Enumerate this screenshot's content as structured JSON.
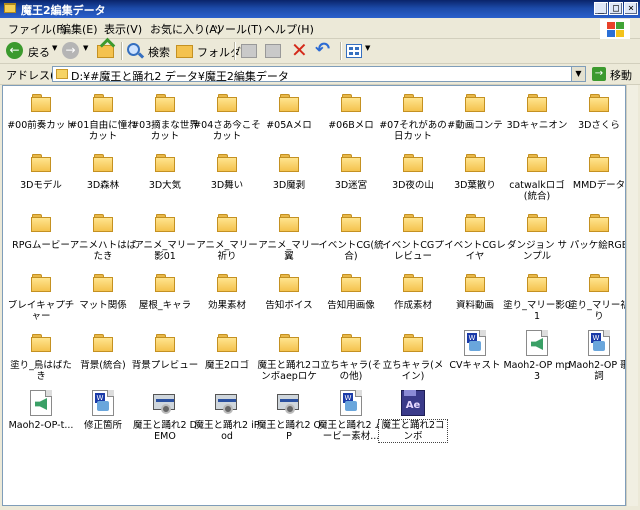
{
  "window": {
    "title": "魔王2編集データ",
    "controls": [
      "_",
      "□",
      "×"
    ]
  },
  "menu": [
    "ファイル(F)",
    "編集(E)",
    "表示(V)",
    "お気に入り(A)",
    "ツール(T)",
    "ヘルプ(H)"
  ],
  "toolbar": {
    "back_label": "戻る",
    "search_label": "検索",
    "folder_label": "フォルダ"
  },
  "address": {
    "label": "アドレス(D)",
    "path": "D:¥#魔王と踊れ2 データ¥魔王2編集データ",
    "go_label": "移動"
  },
  "items": [
    {
      "label": "#00前奏カット",
      "type": "folder"
    },
    {
      "label": "#01自由に憧れカット",
      "type": "folder"
    },
    {
      "label": "#03摘まな世界カット",
      "type": "folder"
    },
    {
      "label": "#04さあ今こそカット",
      "type": "folder"
    },
    {
      "label": "#05Aメロ",
      "type": "folder"
    },
    {
      "label": "#06Bメロ",
      "type": "folder"
    },
    {
      "label": "#07それがあの日カット",
      "type": "folder"
    },
    {
      "label": "#動画コンテ",
      "type": "folder"
    },
    {
      "label": "3Dキャニオン",
      "type": "folder"
    },
    {
      "label": "3Dさくら",
      "type": "folder"
    },
    {
      "label": "3Dモデル",
      "type": "folder"
    },
    {
      "label": "3D森林",
      "type": "folder"
    },
    {
      "label": "3D大気",
      "type": "folder"
    },
    {
      "label": "3D舞い",
      "type": "folder"
    },
    {
      "label": "3D魔剥",
      "type": "folder"
    },
    {
      "label": "3D迷宮",
      "type": "folder"
    },
    {
      "label": "3D夜の山",
      "type": "folder"
    },
    {
      "label": "3D葉散り",
      "type": "folder"
    },
    {
      "label": "catwalkロゴ(統合)",
      "type": "folder"
    },
    {
      "label": "MMDデータ",
      "type": "folder"
    },
    {
      "label": "RPGムービー",
      "type": "folder"
    },
    {
      "label": "アニメハトはばたき",
      "type": "folder"
    },
    {
      "label": "アニメ_マリー影01",
      "type": "folder"
    },
    {
      "label": "アニメ_マリー祈り",
      "type": "folder"
    },
    {
      "label": "アニメ_マリー翼",
      "type": "folder"
    },
    {
      "label": "イベントCG(統合)",
      "type": "folder"
    },
    {
      "label": "イベントCGプレビュー",
      "type": "folder"
    },
    {
      "label": "イベントCGレイヤ",
      "type": "folder"
    },
    {
      "label": "ダンジョン サンプル",
      "type": "folder"
    },
    {
      "label": "パッケ絵RGB",
      "type": "folder"
    },
    {
      "label": "ブレイキャプチャー",
      "type": "folder"
    },
    {
      "label": "マット関係",
      "type": "folder"
    },
    {
      "label": "屋根_キャラ",
      "type": "folder"
    },
    {
      "label": "効果素材",
      "type": "folder"
    },
    {
      "label": "告知ボイス",
      "type": "folder"
    },
    {
      "label": "告知用画像",
      "type": "folder"
    },
    {
      "label": "作成素材",
      "type": "folder"
    },
    {
      "label": "資料動画",
      "type": "folder"
    },
    {
      "label": "塗り_マリー影01",
      "type": "folder"
    },
    {
      "label": "塗り_マリー祈り",
      "type": "folder"
    },
    {
      "label": "塗り_鳥はばたき",
      "type": "folder"
    },
    {
      "label": "背景(統合)",
      "type": "folder"
    },
    {
      "label": "背景プレビュー",
      "type": "folder"
    },
    {
      "label": "魔王2ロゴ",
      "type": "folder"
    },
    {
      "label": "魔王と踊れ2コンボaepロケ",
      "type": "folder"
    },
    {
      "label": "立ちキャラ(その他)",
      "type": "folder"
    },
    {
      "label": "立ちキャラ(メイン)",
      "type": "folder"
    },
    {
      "label": "CVキャスト",
      "type": "word"
    },
    {
      "label": "Maoh2-OP mp3",
      "type": "audio"
    },
    {
      "label": "Maoh2-OP 歌詞",
      "type": "word"
    },
    {
      "label": "Maoh2-OP-t...",
      "type": "audio"
    },
    {
      "label": "修正箇所",
      "type": "word"
    },
    {
      "label": "魔王と踊れ2 DEMO",
      "type": "exe"
    },
    {
      "label": "魔王と踊れ2 iPod",
      "type": "exe"
    },
    {
      "label": "魔王と踊れ2 OP",
      "type": "exe"
    },
    {
      "label": "魔王と踊れ2 ムービー素材...",
      "type": "word"
    },
    {
      "label": "魔王と踊れ2コンボ",
      "type": "ae",
      "selected": true
    }
  ],
  "icon_names": {
    "folder": "folder-icon",
    "word": "word-document-icon",
    "audio": "audio-file-icon",
    "exe": "application-icon",
    "ae": "after-effects-project-icon"
  },
  "colors": {
    "titlebar": "#0a246a",
    "window_bg": "#ece9d8",
    "content_bg": "#ffffff",
    "folder": "#f4c24e"
  }
}
